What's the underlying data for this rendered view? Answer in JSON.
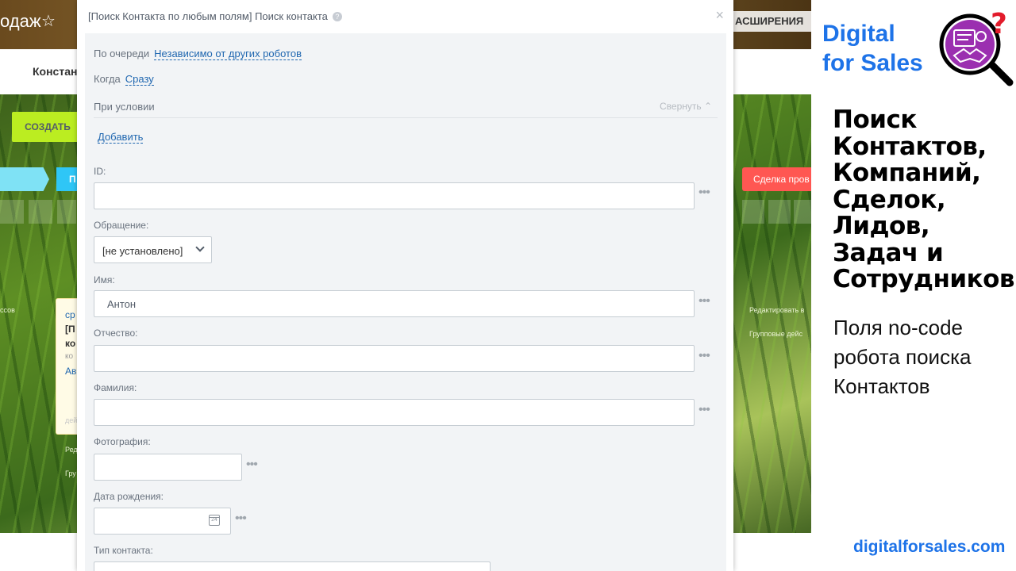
{
  "background": {
    "title_fragment": "одаж",
    "extensions_fragment": "АСШИРЕНИЯ",
    "subbar_fragment": "Констан",
    "create_button": "СОЗДАТЬ",
    "stage_fragment": "П",
    "stage_fail": "Сделка пров",
    "left_labels": [
      "ссов",
      "ср",
      "[П",
      "ко",
      "ко",
      "Ав",
      "дей",
      "Ред",
      "Гру"
    ],
    "right_labels": [
      "Редактировать в",
      "Групповые дейс"
    ]
  },
  "modal": {
    "title": "[Поиск Контакта по любым полям] Поиск контакта",
    "queue_label": "По очереди",
    "queue_value": "Независимо от других роботов",
    "when_label": "Когда",
    "when_value": "Сразу",
    "condition_label": "При условии",
    "collapse_label": "Свернуть",
    "add_label": "Добавить",
    "fields": {
      "id_label": "ID:",
      "salutation_label": "Обращение:",
      "salutation_value": "[не установлено]",
      "name_label": "Имя:",
      "name_value": "Антон",
      "patronymic_label": "Отчество:",
      "surname_label": "Фамилия:",
      "photo_label": "Фотография:",
      "birthdate_label": "Дата рождения:",
      "calendar_day": "24",
      "contact_type_label": "Тип контакта:"
    },
    "more_icon": "•••"
  },
  "promo": {
    "brand": [
      "Digital",
      "for Sales"
    ],
    "headline": [
      "Поиск",
      "Контактов,",
      "Компаний,",
      "Сделок,",
      "Лидов,",
      "Задач и",
      "Сотрудников"
    ],
    "subtext": [
      "Поля no-code",
      "робота поиска",
      "Контактов"
    ],
    "website": "digitalforsales.com",
    "accent_color": "#1e73e8",
    "logo_color": "#8e2aa3"
  }
}
